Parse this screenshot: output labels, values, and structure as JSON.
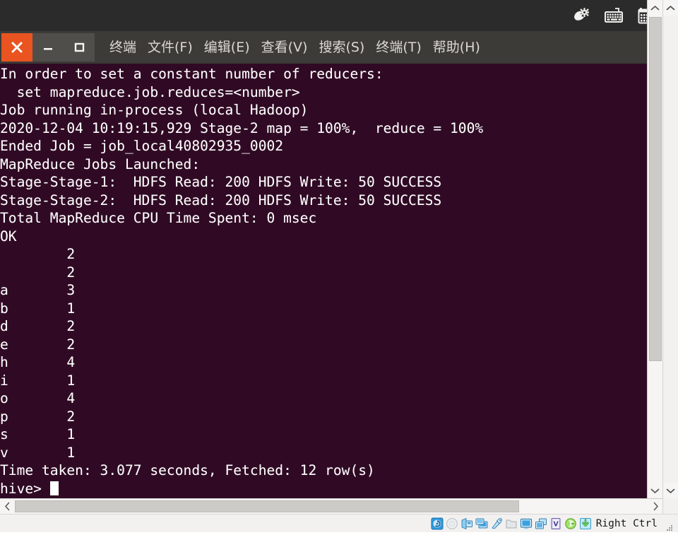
{
  "top_panel": {
    "indicators": [
      {
        "name": "system-settings-icon",
        "glyph": "settings"
      },
      {
        "name": "keyboard-indicator-icon",
        "glyph": "keyboard"
      },
      {
        "name": "calendar-indicator-icon",
        "glyph": "calendar"
      }
    ]
  },
  "window": {
    "close_label": "✕",
    "minimize_label": "—",
    "maximize_label": "☐",
    "menu": [
      {
        "label": "终端"
      },
      {
        "label": "文件(F)"
      },
      {
        "label": "编辑(E)"
      },
      {
        "label": "查看(V)"
      },
      {
        "label": "搜索(S)"
      },
      {
        "label": "终端(T)"
      },
      {
        "label": "帮助(H)"
      }
    ]
  },
  "terminal": {
    "background": "#300a24",
    "foreground": "#ffffff",
    "lines": [
      "In order to set a constant number of reducers:",
      "  set mapreduce.job.reduces=<number>",
      "Job running in-process (local Hadoop)",
      "2020-12-04 10:19:15,929 Stage-2 map = 100%,  reduce = 100%",
      "Ended Job = job_local40802935_0002",
      "MapReduce Jobs Launched:",
      "Stage-Stage-1:  HDFS Read: 200 HDFS Write: 50 SUCCESS",
      "Stage-Stage-2:  HDFS Read: 200 HDFS Write: 50 SUCCESS",
      "Total MapReduce CPU Time Spent: 0 msec",
      "OK",
      "        2",
      "        2",
      "a       3",
      "b       1",
      "d       2",
      "e       2",
      "h       4",
      "i       1",
      "o       4",
      "p       2",
      "s       1",
      "v       1",
      "Time taken: 3.077 seconds, Fetched: 12 row(s)"
    ],
    "prompt": "hive> ",
    "result_rows": [
      {
        "key": "",
        "count": "2"
      },
      {
        "key": "",
        "count": "2"
      },
      {
        "key": "a",
        "count": "3"
      },
      {
        "key": "b",
        "count": "1"
      },
      {
        "key": "d",
        "count": "2"
      },
      {
        "key": "e",
        "count": "2"
      },
      {
        "key": "h",
        "count": "4"
      },
      {
        "key": "i",
        "count": "1"
      },
      {
        "key": "o",
        "count": "4"
      },
      {
        "key": "p",
        "count": "2"
      },
      {
        "key": "s",
        "count": "1"
      },
      {
        "key": "v",
        "count": "1"
      }
    ],
    "scroll": {
      "v_up_arrow": "⌃",
      "v_down_arrow": "⌄",
      "h_left_arrow": "‹",
      "h_right_arrow": "›"
    }
  },
  "vbox_status": {
    "icons": [
      {
        "name": "hard-disk-icon"
      },
      {
        "name": "optical-disk-icon"
      },
      {
        "name": "floppy-disk-icon"
      },
      {
        "name": "network-adapter-icon"
      },
      {
        "name": "usb-device-icon"
      },
      {
        "name": "shared-folder-icon"
      },
      {
        "name": "display-icon"
      },
      {
        "name": "video-capture-icon"
      },
      {
        "name": "virtualization-icon"
      },
      {
        "name": "mouse-capture-icon"
      },
      {
        "name": "host-key-icon"
      }
    ],
    "host_key_label": "Right Ctrl",
    "resize-grip": "resize-grip-icon"
  }
}
